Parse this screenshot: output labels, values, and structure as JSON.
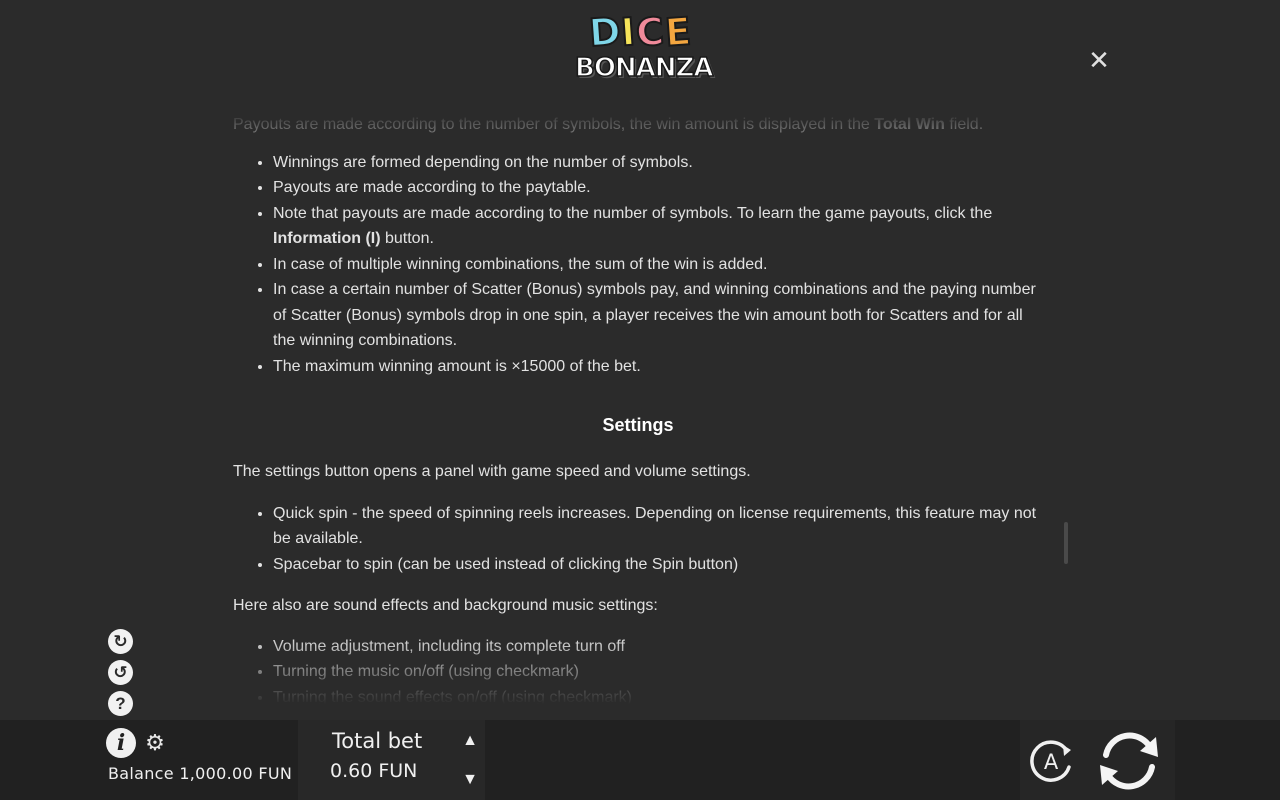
{
  "header": {
    "logo_letters": [
      "D",
      "I",
      "C",
      "E"
    ],
    "logo_colors": [
      "#7fd6e8",
      "#f6e45a",
      "#f08a9a",
      "#f3a640"
    ],
    "logo_bottom": "BONANZA",
    "close_glyph": "✕"
  },
  "rules": {
    "intro": {
      "before": "Payouts are made according to the number of symbols, the win amount is displayed in the ",
      "bold": "Total Win",
      "after": " field."
    },
    "win_items": [
      "Winnings are formed depending on the number of symbols.",
      "Payouts are made according to the paytable.",
      "In case of multiple winning combinations, the sum of the win is added.",
      "In case a certain number of Scatter (Bonus) symbols pay, and winning combinations and the paying number of Scatter (Bonus) symbols drop in one spin, a player receives the win amount both for Scatters and for all the winning combinations.",
      "The maximum winning amount is ×15000 of the bet."
    ],
    "note_item": {
      "before": "Note that payouts are made according to the number of symbols. To learn the game payouts, click the ",
      "bold": "Information (I)",
      "after": " button."
    },
    "settings_title": "Settings",
    "settings_intro": "The settings button opens a panel with game speed and volume settings.",
    "settings_items": [
      "Quick spin - the speed of spinning reels increases. Depending on license requirements, this feature may not be available.",
      "Spacebar to spin (can be used instead of clicking the Spin button)"
    ],
    "sound_intro": "Here also are sound effects and background music settings:",
    "sound_items": [
      "Volume adjustment, including its complete turn off",
      "Turning the music on/off (using checkmark)",
      "Turning the sound effects on/off (using checkmark)"
    ]
  },
  "side_icons": {
    "icon1_glyph": "↻",
    "icon2_glyph": "↺",
    "help_glyph": "?"
  },
  "footer": {
    "info_glyph": "i",
    "gear_glyph": "⚙",
    "balance_label": "Balance",
    "balance_value": "1,000.00 FUN",
    "total_bet_label": "Total bet",
    "total_bet_value": "0.60 FUN",
    "bet_up_glyph": "▲",
    "bet_down_glyph": "▼",
    "auto_label": "A"
  }
}
